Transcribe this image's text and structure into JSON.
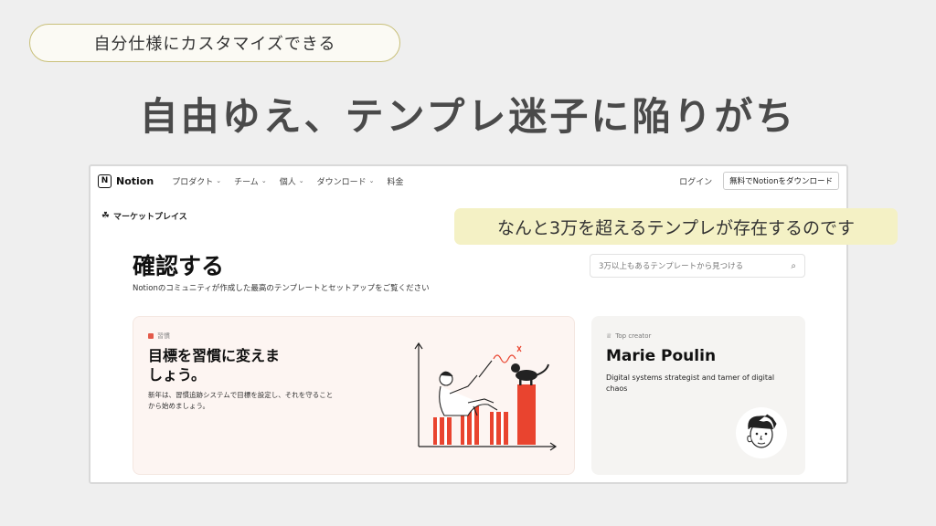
{
  "slide": {
    "pill_text": "自分仕様にカスタマイズできる",
    "title": "自由ゆえ、テンプレ迷子に陥りがち",
    "callout": "なんと3万を超えるテンプレが存在するのです"
  },
  "nav": {
    "logo_text": "Notion",
    "logo_glyph": "N",
    "items": [
      {
        "label": "プロダクト",
        "has_chevron": true
      },
      {
        "label": "チーム",
        "has_chevron": true
      },
      {
        "label": "個人",
        "has_chevron": true
      },
      {
        "label": "ダウンロード",
        "has_chevron": true
      },
      {
        "label": "料金",
        "has_chevron": false
      }
    ],
    "chevron": "⌄",
    "login": "ログイン",
    "download_button": "無料でNotionをダウンロード"
  },
  "marketplace": {
    "label": "マーケットプレイス",
    "icon": "☘"
  },
  "main": {
    "title": "確認する",
    "subtitle": "Notionのコミュニティが作成した最高のテンプレートとセットアップをご覧ください",
    "search_placeholder": "3万以上もあるテンプレートから見つける",
    "search_icon": "⌕"
  },
  "featured_card": {
    "tag": "習慣",
    "heading": "目標を習慣に変えましょう。",
    "description": "新年は、習慣追跡システムで目標を設定し、それを守ることから始めましょう。",
    "accent_color": "#e9442f"
  },
  "creator_card": {
    "label": "Top creator",
    "label_icon": "♕",
    "name": "Marie Poulin",
    "description": "Digital systems strategist and tamer of digital chaos"
  }
}
